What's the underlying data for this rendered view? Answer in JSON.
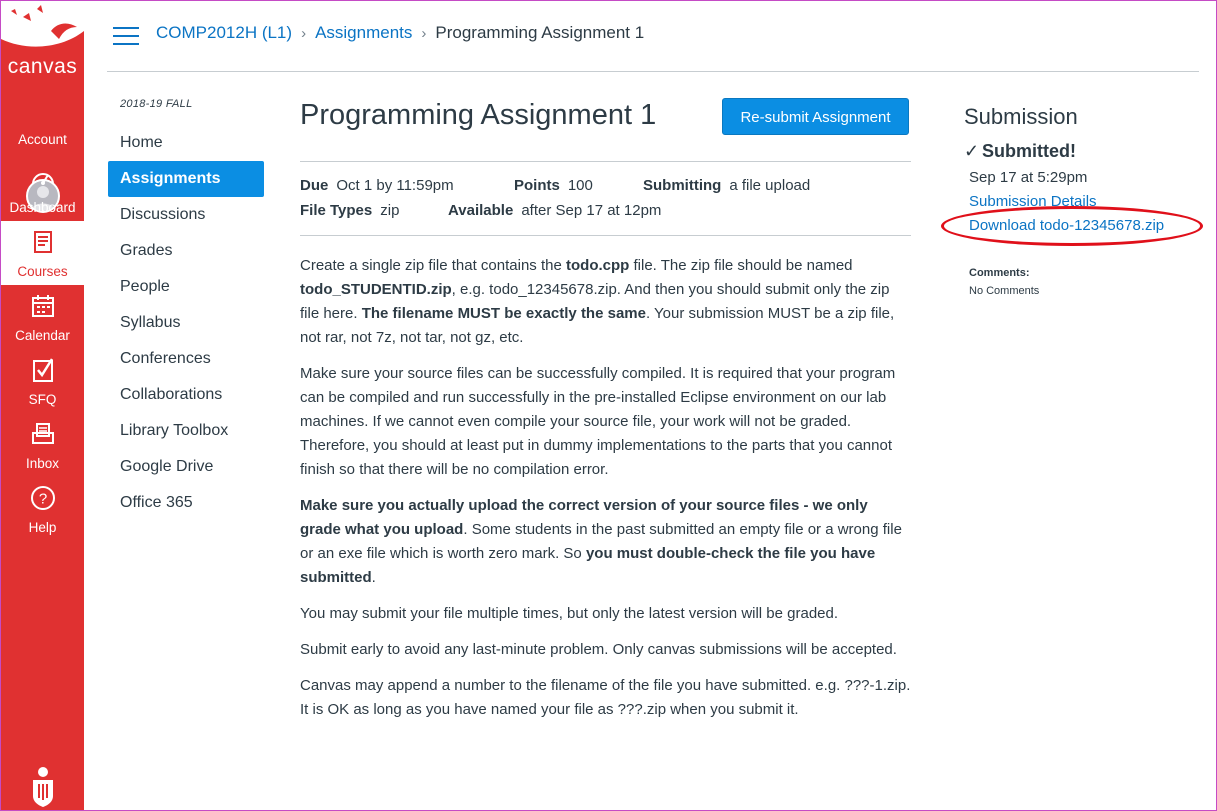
{
  "app": {
    "brand": "canvas"
  },
  "global_nav": [
    {
      "label": "Account",
      "icon": "account-avatar-icon"
    },
    {
      "label": "Dashboard",
      "icon": "dashboard-icon"
    },
    {
      "label": "Courses",
      "icon": "courses-icon",
      "active": true
    },
    {
      "label": "Calendar",
      "icon": "calendar-icon"
    },
    {
      "label": "SFQ",
      "icon": "sfq-checkbox-icon"
    },
    {
      "label": "Inbox",
      "icon": "inbox-icon"
    },
    {
      "label": "Help",
      "icon": "help-icon"
    }
  ],
  "breadcrumb": {
    "course": "COMP2012H (L1)",
    "section": "Assignments",
    "current": "Programming Assignment 1"
  },
  "course_nav": {
    "term": "2018-19 FALL",
    "items": [
      "Home",
      "Assignments",
      "Discussions",
      "Grades",
      "People",
      "Syllabus",
      "Conferences",
      "Collaborations",
      "Library Toolbox",
      "Google Drive",
      "Office 365"
    ],
    "active": "Assignments"
  },
  "assignment": {
    "title": "Programming Assignment 1",
    "resubmit_label": "Re-submit Assignment",
    "due_label": "Due",
    "due_value": "Oct 1 by 11:59pm",
    "points_label": "Points",
    "points_value": "100",
    "submitting_label": "Submitting",
    "submitting_value": "a file upload",
    "filetypes_label": "File Types",
    "filetypes_value": "zip",
    "available_label": "Available",
    "available_value": "after Sep 17 at 12pm"
  },
  "description": {
    "p1": [
      "Create a single zip file that contains the ",
      "todo.cpp",
      " file. The zip file should be named ",
      "todo_STUDENTID.zip",
      ", e.g. todo_12345678.zip. And then you should submit only the zip file here. ",
      "The filename MUST be exactly the same",
      ". Your submission MUST be a zip file, not rar, not 7z, not tar, not gz, etc."
    ],
    "p2": "Make sure your source files can be successfully compiled. It is required that your program can be compiled and run successfully in the pre-installed Eclipse environment on our lab machines. If we cannot even compile your source file, your work will not be graded. Therefore, you should at least put in dummy implementations to the parts that you cannot finish so that there will be no compilation error.",
    "p3": [
      "Make sure you actually upload the correct version of your source files - we only grade what you upload",
      ". Some students in the past submitted an empty file or a wrong file or an exe file which is worth zero mark. So ",
      "you must double-check the file you have submitted",
      "."
    ],
    "p4": "You may submit your file multiple times, but only the latest version will be graded.",
    "p5": "Submit early to avoid any last-minute problem. Only canvas submissions will be accepted.",
    "p6": "Canvas may append a number to the filename of the file you have submitted. e.g. ???-1.zip. It is OK as long as you have named your file as ???.zip when you submit it."
  },
  "submission": {
    "title": "Submission",
    "status": "Submitted!",
    "date": "Sep 17 at 5:29pm",
    "details_link": "Submission Details",
    "download_link": "Download todo-12345678.zip",
    "comments_label": "Comments:",
    "comments_value": "No Comments"
  },
  "colors": {
    "nav_red": "#e03131",
    "link_blue": "#0b74c4",
    "button_blue": "#0b8ee3",
    "highlight_red": "#e0101a"
  }
}
